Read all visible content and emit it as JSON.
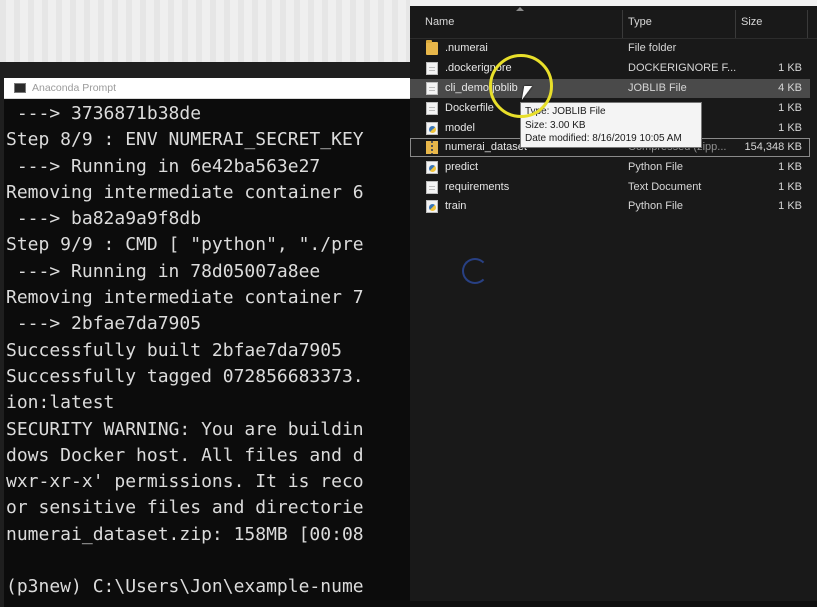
{
  "prompt_window": {
    "title": "Anaconda Prompt",
    "lines": [
      " ---> 3736871b38de",
      "Step 8/9 : ENV NUMERAI_SECRET_KEY",
      " ---> Running in 6e42ba563e27",
      "Removing intermediate container 6",
      " ---> ba82a9a9f8db",
      "Step 9/9 : CMD [ \"python\", \"./pre",
      " ---> Running in 78d05007a8ee",
      "Removing intermediate container 7",
      " ---> 2bfae7da7905",
      "Successfully built 2bfae7da7905",
      "Successfully tagged 072856683373.",
      "ion:latest",
      "SECURITY WARNING: You are buildin",
      "dows Docker host. All files and d",
      "wxr-xr-x' permissions. It is reco",
      "or sensitive files and directorie",
      "numerai_dataset.zip: 158MB [00:08",
      "",
      "(p3new) C:\\Users\\Jon\\example-nume"
    ]
  },
  "explorer": {
    "columns": {
      "name": "Name",
      "type": "Type",
      "size": "Size"
    },
    "files": [
      {
        "name": ".numerai",
        "type": "File folder",
        "size": "",
        "icon": "folder-icon"
      },
      {
        "name": ".dockerignore",
        "type": "DOCKERIGNORE F...",
        "size": "1 KB",
        "icon": "doc-icon"
      },
      {
        "name": "cli_demo.joblib",
        "type": "JOBLIB File",
        "size": "4 KB",
        "icon": "doc-icon"
      },
      {
        "name": "Dockerfile",
        "type": "",
        "size": "1 KB",
        "icon": "doc-icon"
      },
      {
        "name": "model",
        "type": "",
        "size": "1 KB",
        "icon": "python-file-icon"
      },
      {
        "name": "numerai_dataset",
        "type": "Compressed (zipp...",
        "size": "154,348 KB",
        "icon": "zip-folder-icon"
      },
      {
        "name": "predict",
        "type": "Python File",
        "size": "1 KB",
        "icon": "python-file-icon"
      },
      {
        "name": "requirements",
        "type": "Text Document",
        "size": "1 KB",
        "icon": "doc-icon"
      },
      {
        "name": "train",
        "type": "Python File",
        "size": "1 KB",
        "icon": "python-file-icon"
      }
    ],
    "tooltip": {
      "type": "Type: JOBLIB File",
      "size": "Size: 3.00 KB",
      "modified": "Date modified: 8/16/2019 10:05 AM"
    }
  },
  "colors": {
    "highlight": "#e8df2a",
    "selection": "#4a4a4a",
    "console_bg": "#0c0c0c"
  }
}
